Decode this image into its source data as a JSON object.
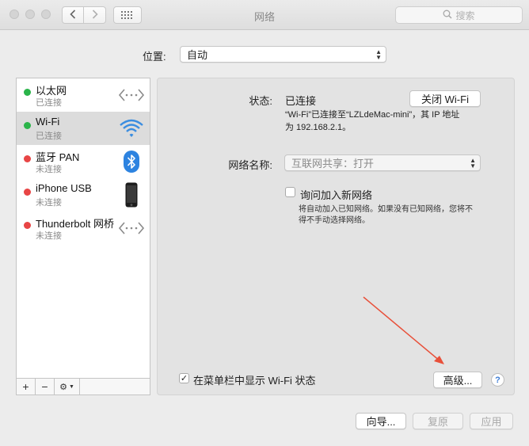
{
  "window": {
    "title": "网络"
  },
  "search": {
    "placeholder": "搜索"
  },
  "location": {
    "label": "位置:",
    "value": "自动"
  },
  "services": [
    {
      "name": "以太网",
      "status": "已连接",
      "status_color": "#2bb44a",
      "icon": "ethernet-icon"
    },
    {
      "name": "Wi-Fi",
      "status": "已连接",
      "status_color": "#2bb44a",
      "icon": "wifi-icon",
      "selected": true
    },
    {
      "name": "蓝牙 PAN",
      "status": "未连接",
      "status_color": "#e84545",
      "icon": "bluetooth-icon"
    },
    {
      "name": "iPhone USB",
      "status": "未连接",
      "status_color": "#e84545",
      "icon": "iphone-icon"
    },
    {
      "name": "Thunderbolt 网桥",
      "status": "未连接",
      "status_color": "#e84545",
      "icon": "thunderbolt-bridge-icon"
    }
  ],
  "sidebar_controls": {
    "add": "+",
    "remove": "−",
    "gear": "⚙︎"
  },
  "detail": {
    "status_label": "状态:",
    "status_value": "已连接",
    "turn_off_button": "关闭 Wi-Fi",
    "status_desc_line1": "“Wi-Fi”已连接至“LZLdeMac-mini”，其 IP 地址",
    "status_desc_line2": "为 192.168.2.1。",
    "network_name_label": "网络名称:",
    "network_name_value": "互联网共享：打开",
    "ask_join_label": "询问加入新网络",
    "ask_join_desc_line1": "将自动加入已知网络。如果没有已知网络，您将不",
    "ask_join_desc_line2": "得不手动选择网络。",
    "show_menubar_label": "在菜单栏中显示 Wi-Fi 状态",
    "show_menubar_checked": true,
    "advanced_button": "高级...",
    "help": "?"
  },
  "footer": {
    "assist_button": "向导...",
    "revert_button": "复原",
    "apply_button": "应用"
  },
  "colors": {
    "annotation_arrow": "#e8503a",
    "accent": "#3b7bd4"
  }
}
